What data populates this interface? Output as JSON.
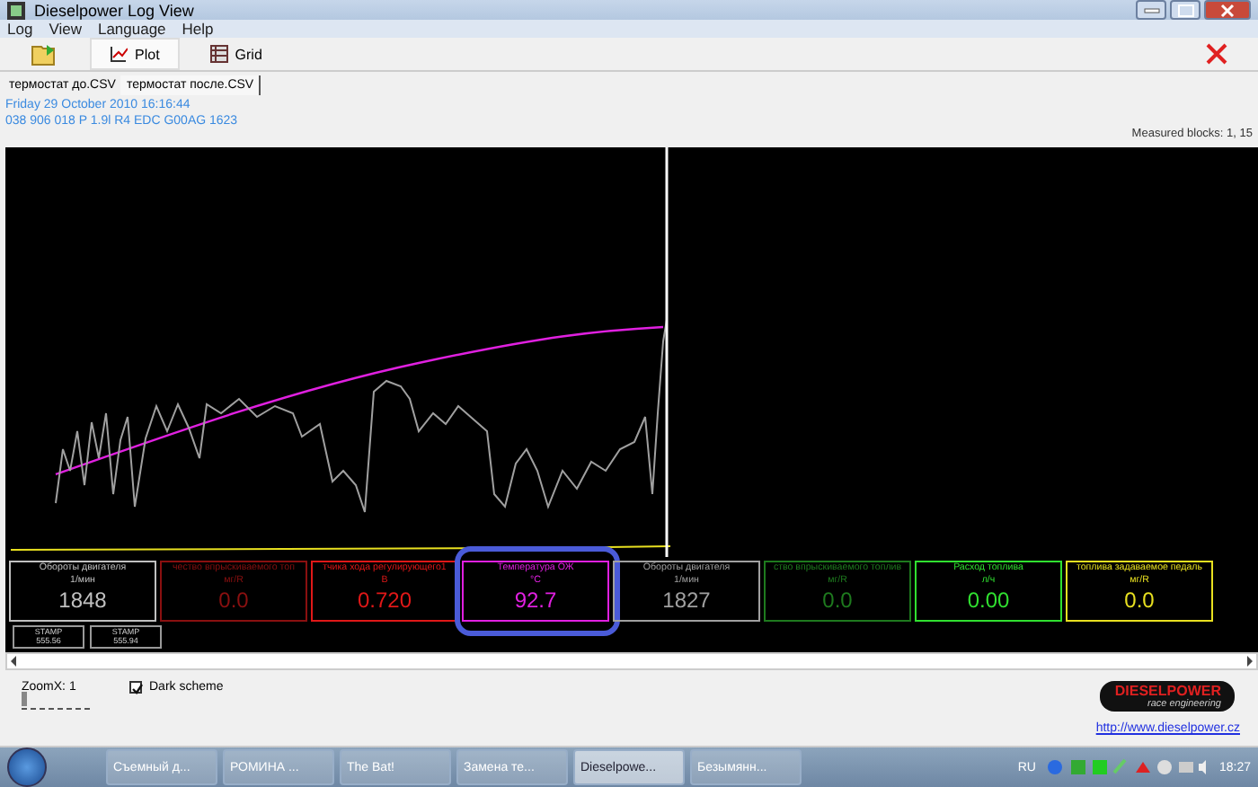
{
  "window": {
    "title": "Dieselpower Log View"
  },
  "menu": [
    "Log",
    "View",
    "Language",
    "Help"
  ],
  "toolbar": [
    {
      "label": "Plot",
      "selected": true
    },
    {
      "label": "Grid",
      "selected": false
    }
  ],
  "file_tabs": [
    {
      "label": "термостат до.CSV",
      "selected": false
    },
    {
      "label": "термостат после.CSV",
      "selected": true
    }
  ],
  "info": {
    "date": "Friday 29 October 2010 16:16:44",
    "ecu": "038 906 018 P  1.9l R4 EDC  G00AG  1623",
    "measured_blocks": "Measured blocks: 1, 15"
  },
  "gauges": [
    {
      "title": "Обороты двигателя",
      "unit": "1/мин",
      "value": "1848",
      "color": "#c0c0c0",
      "highlighted": false
    },
    {
      "title": "чество впрыскиваемого топ",
      "unit": "мг/R",
      "value": "0.0",
      "color": "#8a1010",
      "highlighted": false
    },
    {
      "title": "тчика хода регулирующего1",
      "unit": "В",
      "value": "0.720",
      "color": "#e01818",
      "highlighted": false
    },
    {
      "title": "Температура ОЖ",
      "unit": "°C",
      "value": "92.7",
      "color": "#e020e0",
      "highlighted": true
    },
    {
      "title": "Обороты двигателя",
      "unit": "1/мин",
      "value": "1827",
      "color": "#a0a0a0",
      "highlighted": false
    },
    {
      "title": "ство впрыскиваемого топлив",
      "unit": "мг/R",
      "value": "0.0",
      "color": "#1e7a1e",
      "highlighted": false
    },
    {
      "title": "Расход топлива",
      "unit": "л/ч",
      "value": "0.00",
      "color": "#30e030",
      "highlighted": false
    },
    {
      "title": "топлива задаваемое педаль",
      "unit": "мг/R",
      "value": "0.0",
      "color": "#e8e020",
      "highlighted": false
    }
  ],
  "stamps": [
    {
      "label": "STAMP",
      "value": "555.56"
    },
    {
      "label": "STAMP",
      "value": "555.94"
    }
  ],
  "bottom": {
    "zoom_label": "ZoomX: 1",
    "zoom_slider": {
      "level": 0
    },
    "dark_scheme": {
      "label": "Dark scheme",
      "checked": true
    },
    "logo_title": "DIESELPOWER",
    "logo_sub": "race engineering",
    "link": "http://www.dieselpower.cz"
  },
  "taskbar": [
    {
      "label": "Съемный д...",
      "selected": false
    },
    {
      "label": "РОМИНА ...",
      "selected": false
    },
    {
      "label": "The Bat!",
      "selected": false
    },
    {
      "label": "Замена те...",
      "selected": false
    },
    {
      "label": "Dieselpowe...",
      "selected": true
    },
    {
      "label": "Безымянн...",
      "selected": false
    }
  ],
  "tray": {
    "language": "RU",
    "clock": "18:27"
  }
}
